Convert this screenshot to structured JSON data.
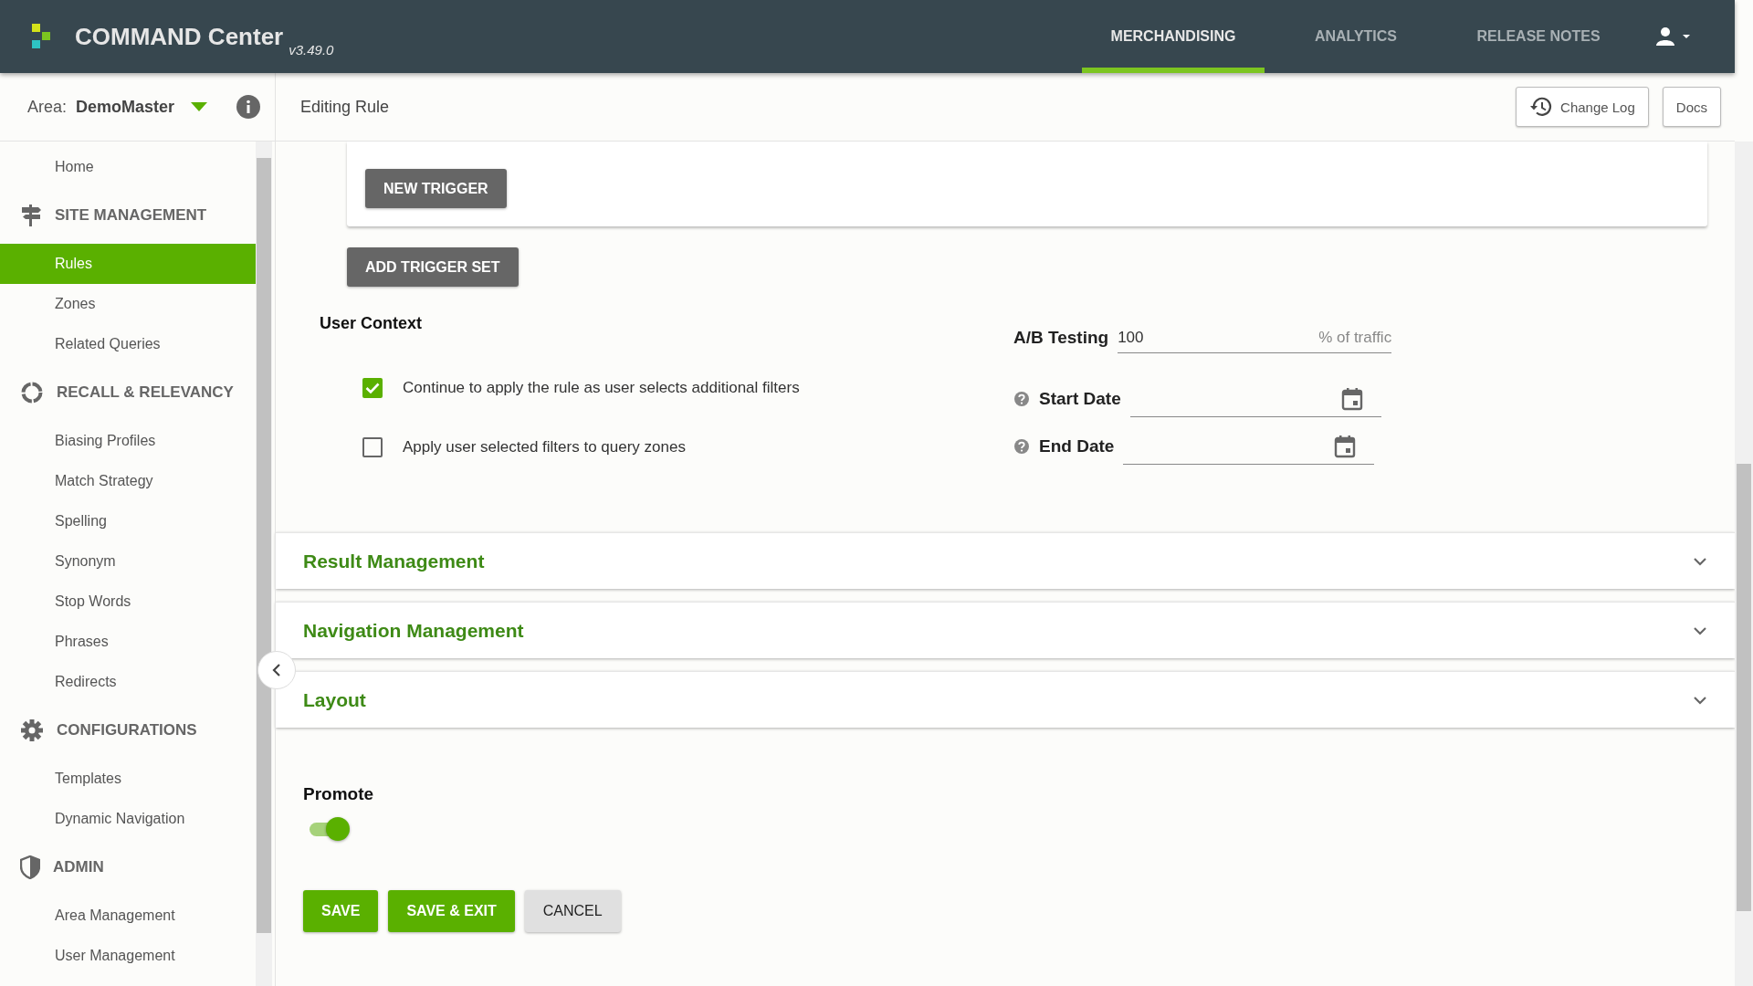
{
  "header": {
    "title": "COMMAND Center",
    "version": "v3.49.0",
    "tabs": [
      {
        "label": "MERCHANDISING",
        "selected": true
      },
      {
        "label": "ANALYTICS",
        "selected": false
      },
      {
        "label": "RELEASE NOTES",
        "selected": false
      }
    ]
  },
  "subheader": {
    "area_label": "Area:",
    "area_value": "DemoMaster",
    "page_title": "Editing Rule",
    "buttons": [
      "Change Log",
      "Docs"
    ]
  },
  "sidebar": {
    "items": [
      {
        "label": "Home",
        "selected": false
      }
    ],
    "sections": [
      {
        "title": "SITE MANAGEMENT",
        "items": [
          {
            "label": "Rules",
            "selected": true
          },
          {
            "label": "Zones",
            "selected": false
          },
          {
            "label": "Related Queries",
            "selected": false
          }
        ]
      },
      {
        "title": "RECALL & RELEVANCY",
        "items": [
          {
            "label": "Biasing Profiles",
            "selected": false
          },
          {
            "label": "Match Strategy",
            "selected": false
          },
          {
            "label": "Spelling",
            "selected": false
          },
          {
            "label": "Synonym",
            "selected": false
          },
          {
            "label": "Stop Words",
            "selected": false
          },
          {
            "label": "Phrases",
            "selected": false
          },
          {
            "label": "Redirects",
            "selected": false
          }
        ]
      },
      {
        "title": "CONFIGURATIONS",
        "items": [
          {
            "label": "Templates",
            "selected": false
          },
          {
            "label": "Dynamic Navigation",
            "selected": false
          }
        ]
      },
      {
        "title": "ADMIN",
        "items": [
          {
            "label": "Area Management",
            "selected": false
          },
          {
            "label": "User Management",
            "selected": false
          }
        ]
      }
    ]
  },
  "triggers": {
    "new_trigger": "NEW TRIGGER",
    "add_trigger_set": "ADD TRIGGER SET"
  },
  "user_context": {
    "title": "User Context",
    "options": [
      {
        "label": "Continue to apply the rule as user selects additional filters",
        "checked": true
      },
      {
        "label": "Apply user selected filters to query zones",
        "checked": false
      }
    ]
  },
  "ab_testing": {
    "label": "A/B Testing",
    "value": "100",
    "suffix": "% of traffic"
  },
  "dates": [
    {
      "label": "Start Date"
    },
    {
      "label": "End Date"
    }
  ],
  "panels": [
    {
      "title": "Result Management",
      "expanded": false
    },
    {
      "title": "Navigation Management",
      "expanded": false
    },
    {
      "title": "Layout",
      "expanded": false
    }
  ],
  "promote": {
    "label": "Promote",
    "on": true
  },
  "actions": [
    {
      "label": "SAVE",
      "kind": "primary"
    },
    {
      "label": "SAVE & EXIT",
      "kind": "primary"
    },
    {
      "label": "CANCEL",
      "kind": "secondary"
    }
  ]
}
